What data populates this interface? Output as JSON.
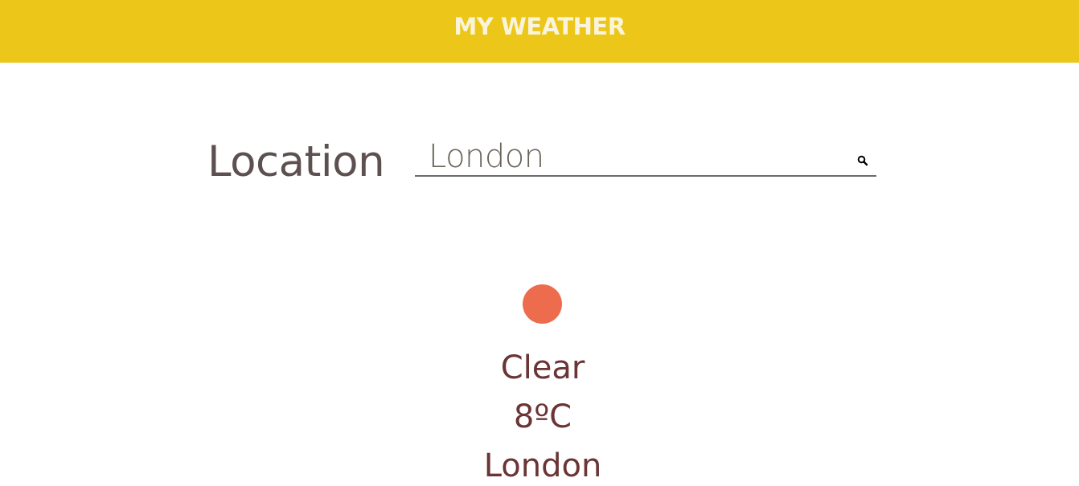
{
  "header": {
    "title": "MY WEATHER"
  },
  "search": {
    "label": "Location",
    "value": "London",
    "icon": "search-icon"
  },
  "weather": {
    "icon": "sun-icon",
    "condition": "Clear",
    "temperature": "8ºC",
    "city": "London"
  },
  "colors": {
    "header_bg": "#ecc719",
    "header_text": "#fbf4dc",
    "label": "#5c5150",
    "sun": "#ee6c4e",
    "weather_text": "#6b3435"
  }
}
